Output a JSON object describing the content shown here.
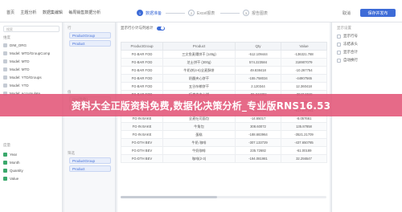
{
  "header": {
    "breadcrumb": [
      "首页",
      "主题分析",
      "数据集编辑",
      "每周销售数据分析"
    ],
    "steps": [
      {
        "num": "1",
        "label": "数据准备"
      },
      {
        "num": "2",
        "label": "Excel报表"
      },
      {
        "num": "3",
        "label": "报告图表"
      }
    ],
    "cancel_label": "取消",
    "save_label": "保存并发布"
  },
  "left_panel": {
    "search_placeholder": "搜索",
    "dimensions_label": "维度",
    "dimension_items": [
      "DIM_ORG",
      "Model: MTD/GroupComp",
      "Model: MTD",
      "Model: MTD",
      "Model: YTD/Groups",
      "Model: YTD",
      "Model: Accumulate"
    ],
    "measures_label": "度量",
    "measure_items": [
      "Year",
      "Month",
      "Quantity",
      "Value"
    ]
  },
  "field_panel": {
    "rows_label": "行",
    "row_chips": [
      "ProductGroup",
      "Product"
    ],
    "values_label": "值",
    "value_chips": [
      "Qty(件数)",
      "Value(金额)"
    ],
    "filter_label": "筛选",
    "filter_chips": [
      "ProductGroup",
      "Product"
    ]
  },
  "main": {
    "toggle_label": "显示行小计与列总计",
    "columns": [
      "ProductGroup",
      "Product",
      "Qty",
      "Value"
    ],
    "rows": [
      [
        "FG-BAR FOD",
        "三文鱼麦穗饼干 (145g)",
        "-512.109444",
        "-136321.788"
      ],
      [
        "FG-BAR FOD",
        "芝士饼干 (300g)",
        "574.223584",
        "318907079"
      ],
      [
        "FG-BAR FOD",
        "牛奶饼(4-6)全麦酥饼",
        "49.838418",
        "-10.267754"
      ],
      [
        "FG-BAR FOD",
        "奶酪夹心饼干",
        "-155.758034",
        "-44907565"
      ],
      [
        "FG-BAR FOD",
        "五谷杂粮饼干",
        "2.120344",
        "12.360418"
      ],
      [
        "FG-BAR FOD",
        "巧克力夹心饼",
        "-86.344002",
        "-3047.8846"
      ],
      [
        "FG-IN BAKE",
        "面包",
        "1.000000",
        "1.00"
      ],
      [
        "FG-IN BAKE",
        "葡萄干-面包",
        "-76.248754",
        "-917.277251"
      ],
      [
        "FG-IN BAKE",
        "全麦吐司面包",
        "-14.65017",
        "-8.057661"
      ],
      [
        "FG-IN BAKE",
        "牛角包",
        "308.60072",
        "135.87858"
      ],
      [
        "FG-IN BAKE",
        "蛋糕",
        "-188.683964",
        "-3521.21709"
      ],
      [
        "FG-DTH BEV",
        "牛奶 咖啡",
        "-307.133729",
        "-437.650785"
      ],
      [
        "FG-DTH BEV",
        "牛奶咖啡",
        "235.72682",
        "-61.00189"
      ],
      [
        "FG-DTH BEV",
        "咖啡(2-3)",
        "-194.081981",
        "32.256547"
      ]
    ]
  },
  "right_panel": {
    "title": "显示设置",
    "options": [
      "显示行号",
      "冻结表头",
      "显示合计",
      "自动换行"
    ]
  },
  "banner": {
    "text": "资料大全正版资料免费,数据化决策分析_专业版RNS16.53"
  }
}
